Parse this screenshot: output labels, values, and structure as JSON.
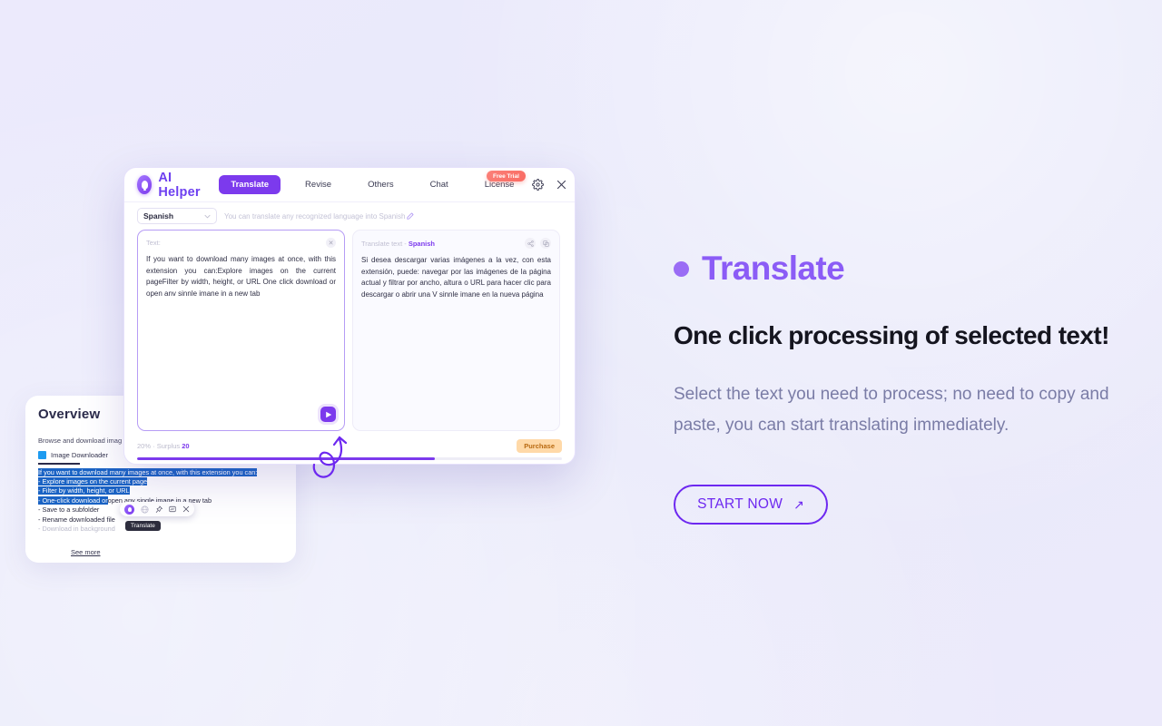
{
  "background": {
    "base_color": "#eaeafb",
    "accent": "#7c3aed"
  },
  "overview_card": {
    "title": "Overview",
    "subtitle": "Browse and download imag",
    "app_name": "Image Downloader",
    "selected_lines": [
      "If you want to download many images at once, with this extension you can:",
      "- Explore images on the current page",
      "- Filter by width, height, or URL",
      "- One-click download or"
    ],
    "trailing_line": "open any single image in a new tab",
    "plain_lines": [
      "- Save to a subfolder",
      "- Rename downloaded file"
    ],
    "dim_line": "- Download in background",
    "see_more": "See more",
    "toolbar": {
      "tooltip": "Translate",
      "icons": [
        "ai-helper-logo-icon",
        "translate-globe-icon",
        "pin-icon",
        "screenshot-icon",
        "close-icon"
      ]
    }
  },
  "helper_window": {
    "brand": "AI Helper",
    "tabs": [
      {
        "label": "Translate",
        "active": true
      },
      {
        "label": "Revise",
        "active": false
      },
      {
        "label": "Others",
        "active": false
      },
      {
        "label": "Chat",
        "active": false
      },
      {
        "label": "License",
        "active": false
      }
    ],
    "badge": "Free Trial",
    "header_icons": [
      "gear-icon",
      "close-icon"
    ],
    "language": {
      "selected": "Spanish",
      "hint": "You can translate any recognized language into Spanish"
    },
    "source_panel": {
      "label": "Text:",
      "content": "If you want to download many images at once, with this extension you can:Explore images on the current pageFilter by width, height, or URL One click download or open anv sinnle imane in a new tab"
    },
    "target_panel": {
      "label": "Translate text - ",
      "language": "Spanish",
      "content": "Si desea descargar varias imágenes a la vez, con esta extensión, puede: navegar por las imágenes de la página actual y filtrar por ancho, altura o URL para hacer clic para descargar o abrir una V sinnle imane en la nueva página"
    },
    "footer": {
      "quota_percent": "20%",
      "quota_separator": "·",
      "quota_label": "Surplus",
      "quota_value": "20",
      "progress_fill_percent": 70,
      "purchase_label": "Purchase"
    }
  },
  "promo": {
    "eyebrow": "Translate",
    "headline": "One click processing of selected text!",
    "subtext_line1": "Select the text you need to process; no need to copy and",
    "subtext_line2": "paste, you can start translating immediately.",
    "cta_label": "START NOW",
    "cta_arrow": "↗"
  }
}
